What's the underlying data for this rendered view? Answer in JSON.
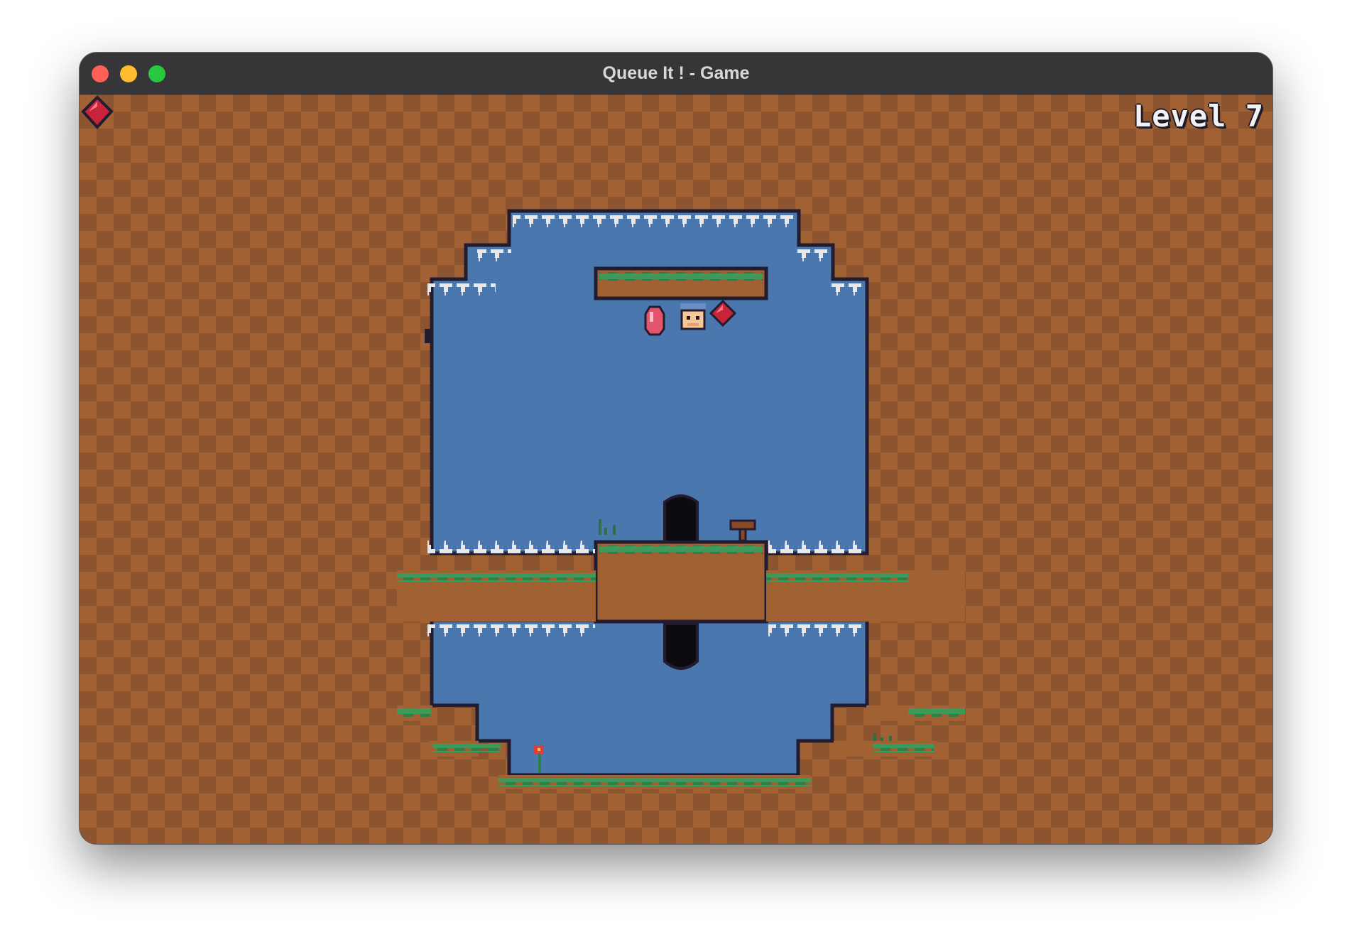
{
  "window": {
    "title": "Queue It ! - Game"
  },
  "hud": {
    "level_label": "Level 7",
    "collected_icon": "red-gem-icon"
  },
  "colors": {
    "dirt_light": "#a26133",
    "dirt_dark": "#8d5430",
    "sky": "#4a77ad",
    "grass": "#3c9a5a",
    "outline": "#221c30",
    "spike": "#e8e8e8",
    "gem_red": "#c8233a",
    "gem_pink": "#e2556a"
  },
  "level_objects": {
    "player": "player-character",
    "door": "exit-door",
    "collectibles": [
      "pink-gem",
      "red-gem"
    ]
  }
}
